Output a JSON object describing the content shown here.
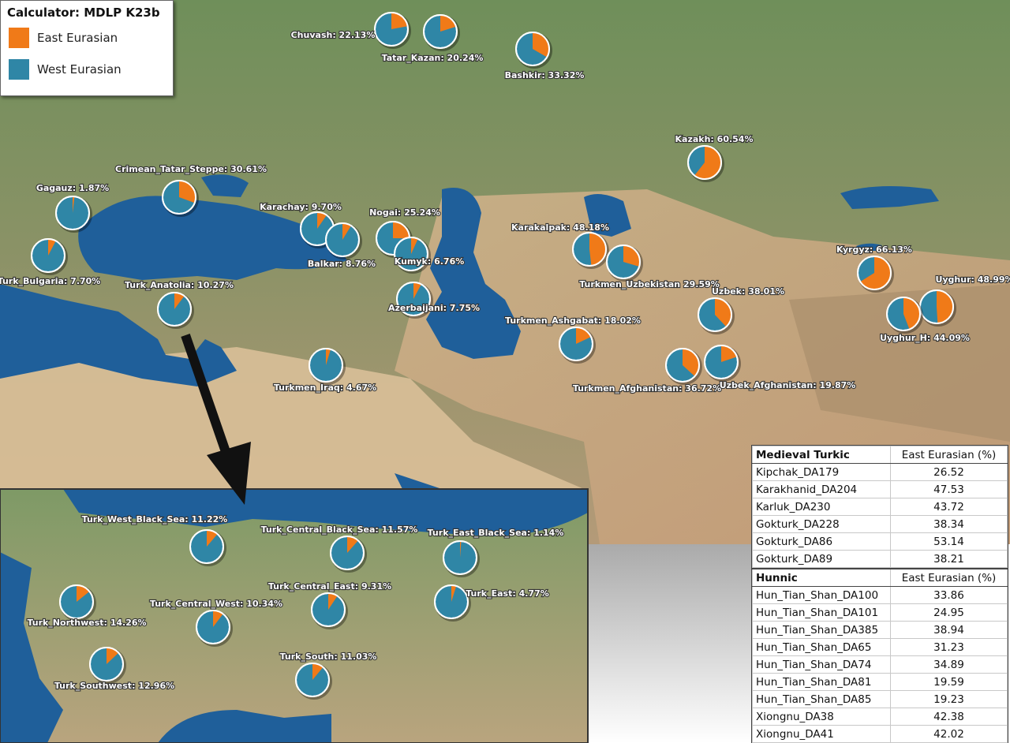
{
  "legend": {
    "title": "Calculator: MDLP K23b",
    "items": [
      {
        "label": "East Eurasian",
        "color": "#f07a18"
      },
      {
        "label": "West Eurasian",
        "color": "#2f86a6"
      }
    ]
  },
  "colors": {
    "east": "#f07a18",
    "west": "#2f86a6",
    "sea": "#1f5f9a"
  },
  "pies": [
    {
      "label": "Chuvash: 22.13%",
      "east": 22.13
    },
    {
      "label": "Tatar_Kazan: 20.24%",
      "east": 20.24
    },
    {
      "label": "Bashkir: 33.32%",
      "east": 33.32
    },
    {
      "label": "Kazakh: 60.54%",
      "east": 60.54
    },
    {
      "label": "Crimean_Tatar_Steppe: 30.61%",
      "east": 30.61
    },
    {
      "label": "Gagauz: 1.87%",
      "east": 1.87
    },
    {
      "label": "Karachay: 9.70%",
      "east": 9.7
    },
    {
      "label": "Balkar: 8.76%",
      "east": 8.76
    },
    {
      "label": "Nogai: 25.24%",
      "east": 25.24
    },
    {
      "label": "Kumyk: 6.76%",
      "east": 6.76
    },
    {
      "label": "Karakalpak: 48.18%",
      "east": 48.18
    },
    {
      "label": "Turkmen_Uzbekistan 29.59%",
      "east": 29.59
    },
    {
      "label": "Kyrgyz: 66.13%",
      "east": 66.13
    },
    {
      "label": "Uyghur: 48.99%",
      "east": 48.99
    },
    {
      "label": "Uyghur_H: 44.09%",
      "east": 44.09
    },
    {
      "label": "Turk_Bulgaria: 7.70%",
      "east": 7.7
    },
    {
      "label": "Turk_Anatolia: 10.27%",
      "east": 10.27
    },
    {
      "label": "Azerbaijani: 7.75%",
      "east": 7.75
    },
    {
      "label": "Uzbek: 38.01%",
      "east": 38.01
    },
    {
      "label": "Turkmen_Ashgabat: 18.02%",
      "east": 18.02
    },
    {
      "label": "Turkmen_Iraq: 4.67%",
      "east": 4.67
    },
    {
      "label": "Turkmen_Afghanistan: 36.72%",
      "east": 36.72
    },
    {
      "label": "Uzbek_Afghanistan: 19.87%",
      "east": 19.87
    },
    {
      "label": "Turk_West_Black_Sea: 11.22%",
      "east": 11.22
    },
    {
      "label": "Turk_Central_Black_Sea: 11.57%",
      "east": 11.57
    },
    {
      "label": "Turk_East_Black_Sea: 1.14%",
      "east": 1.14
    },
    {
      "label": "Turk_Central_East: 9.31%",
      "east": 9.31
    },
    {
      "label": "Turk_East: 4.77%",
      "east": 4.77
    },
    {
      "label": "Turk_Northwest: 14.26%",
      "east": 14.26
    },
    {
      "label": "Turk_Central_West: 10.34%",
      "east": 10.34
    },
    {
      "label": "Turk_South: 11.03%",
      "east": 11.03
    },
    {
      "label": "Turk_Southwest: 12.96%",
      "east": 12.96
    }
  ],
  "tables": [
    {
      "title": "Medieval Turkic",
      "column": "East Eurasian (%)",
      "rows": [
        {
          "name": "Kipchak_DA179",
          "value": "26.52"
        },
        {
          "name": "Karakhanid_DA204",
          "value": "47.53"
        },
        {
          "name": "Karluk_DA230",
          "value": "43.72"
        },
        {
          "name": "Gokturk_DA228",
          "value": "38.34"
        },
        {
          "name": "Gokturk_DA86",
          "value": "53.14"
        },
        {
          "name": "Gokturk_DA89",
          "value": "38.21"
        }
      ]
    },
    {
      "title": "Hunnic",
      "column": "East Eurasian (%)",
      "rows": [
        {
          "name": "Hun_Tian_Shan_DA100",
          "value": "33.86"
        },
        {
          "name": "Hun_Tian_Shan_DA101",
          "value": "24.95"
        },
        {
          "name": "Hun_Tian_Shan_DA385",
          "value": "38.94"
        },
        {
          "name": "Hun_Tian_Shan_DA65",
          "value": "31.23"
        },
        {
          "name": "Hun_Tian_Shan_DA74",
          "value": "34.89"
        },
        {
          "name": "Hun_Tian_Shan_DA81",
          "value": "19.59"
        },
        {
          "name": "Hun_Tian_Shan_DA85",
          "value": "19.23"
        },
        {
          "name": "Xiongnu_DA38",
          "value": "42.38"
        },
        {
          "name": "Xiongnu_DA41",
          "value": "42.02"
        }
      ]
    }
  ]
}
